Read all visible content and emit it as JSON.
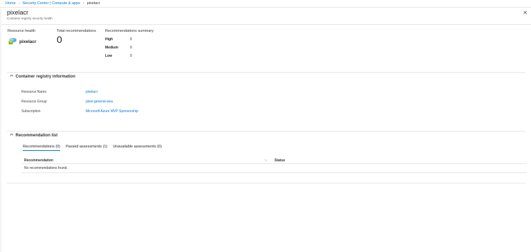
{
  "breadcrumb": {
    "home": "Home",
    "security_center": "Security Center | Compute & apps",
    "current": "pixelacr"
  },
  "blade": {
    "title": "pixelacr",
    "subtitle": "Container registry security health",
    "close": "✕"
  },
  "summary": {
    "resource_health_label": "Resource health",
    "resource_name": "pixelacr",
    "total_label": "Total recommendations",
    "total_value": "0",
    "rec_summary_label": "Recommendations summary",
    "severities": [
      {
        "label": "High",
        "value": "0"
      },
      {
        "label": "Medium",
        "value": "0"
      },
      {
        "label": "Low",
        "value": "0"
      }
    ]
  },
  "registry_info": {
    "title": "Container registry information",
    "rows": [
      {
        "label": "Resource Name",
        "value": "pixelacr"
      },
      {
        "label": "Resource Group",
        "value": "pixel-general-weu"
      },
      {
        "label": "Subscription",
        "value": "Microsoft Azure MVP Sponsorship"
      }
    ]
  },
  "rec_list": {
    "title": "Recommendation list",
    "tabs": [
      "Recommendations (0)",
      "Passed assessments (1)",
      "Unavailable assessments (0)"
    ],
    "columns": {
      "recommendation": "Recommendation",
      "status": "Status"
    },
    "empty": "No recommendations found."
  },
  "colors": {
    "accent": "#0078d4"
  },
  "icons": {
    "resource": "container-registry-icon",
    "chevron": "chevron-up-icon",
    "sort": "sort-icon"
  }
}
